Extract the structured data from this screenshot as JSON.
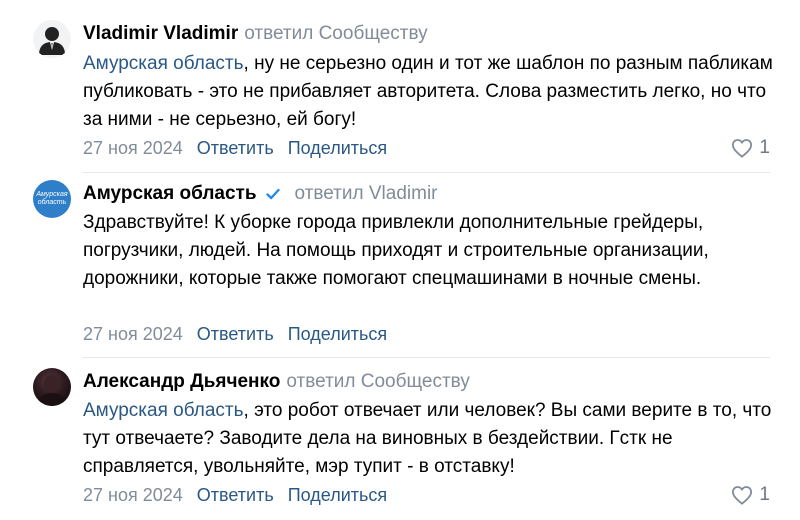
{
  "comments": [
    {
      "author": "Vladimir Vladimir",
      "verified": false,
      "replied_to": "ответил Сообществу",
      "mention": "Амурская область",
      "text": ", ну не серьезно один и тот же шаблон по разным пабликам публиковать - это не прибавляет авторитета. Слова разместить легко, но что за ними - не серьезно, ей богу!",
      "date": "27 ноя 2024",
      "reply_label": "Ответить",
      "share_label": "Поделиться",
      "likes": "1",
      "avatar_icon": "default-user-icon"
    },
    {
      "author": "Амурская область",
      "verified": true,
      "replied_to": "ответил Vladimir",
      "mention": "",
      "text": "Здравствуйте! К уборке города привлекли дополнительные грейдеры, погрузчики, людей. На помощь приходят и строительные организации, дорожники, которые также помогают спецмашинами в ночные смены.",
      "date": "27 ноя 2024",
      "reply_label": "Ответить",
      "share_label": "Поделиться",
      "likes": "",
      "avatar_text": "Амурская область"
    },
    {
      "author": "Александр Дьяченко",
      "verified": false,
      "replied_to": "ответил Сообществу",
      "mention": "Амурская область",
      "text": ", это робот отвечает или человек? Вы сами верите в то, что тут отвечаете? Заводите дела на виновных в бездействии. Гстк не справляется, увольняйте, мэр тупит - в отставку!",
      "date": "27 ноя 2024",
      "reply_label": "Ответить",
      "share_label": "Поделиться",
      "likes": "1",
      "avatar_icon": "user-photo"
    }
  ],
  "colors": {
    "link": "#2a5885",
    "muted": "#818c99",
    "verified": "#2688eb",
    "divider": "#e7e8ec"
  }
}
